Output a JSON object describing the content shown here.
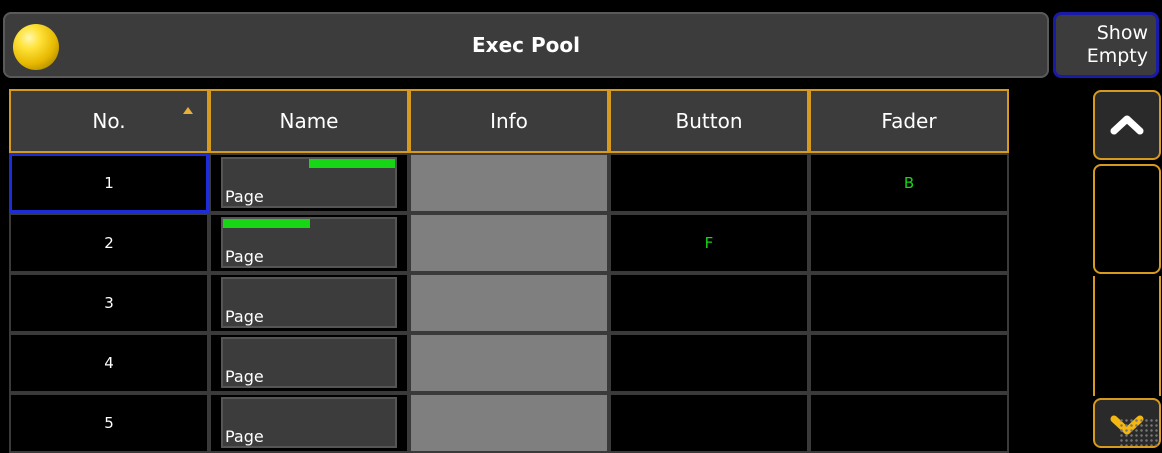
{
  "title": "Exec Pool",
  "show_empty": [
    "Show",
    "Empty"
  ],
  "columns": [
    "No.",
    "Name",
    "Info",
    "Button",
    "Fader"
  ],
  "rows": [
    {
      "no": "1",
      "name": "Page",
      "button": "",
      "fader": "B",
      "bar": "right"
    },
    {
      "no": "2",
      "name": "Page",
      "button": "F",
      "fader": "",
      "bar": "left"
    },
    {
      "no": "3",
      "name": "Page",
      "button": "",
      "fader": "",
      "bar": "none"
    },
    {
      "no": "4",
      "name": "Page",
      "button": "",
      "fader": "",
      "bar": "none"
    },
    {
      "no": "5",
      "name": "Page",
      "button": "",
      "fader": "",
      "bar": "none"
    }
  ],
  "colors": {
    "accent": "#d69a1f",
    "select": "#1c2dd6",
    "indicator": "#16d616"
  },
  "icons": {
    "logo": "yellow-ball-icon",
    "scroll_up": "chevron-up-icon",
    "scroll_down": "chevron-down-icon"
  }
}
